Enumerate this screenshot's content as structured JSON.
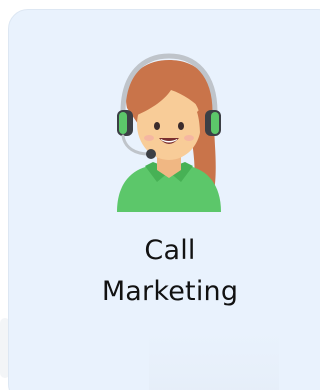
{
  "card": {
    "title_line1": "Call",
    "title_line2": "Marketing",
    "icon": "call-center-agent-icon"
  },
  "colors": {
    "card_background": "#e9f2fd",
    "text": "#121212",
    "shirt": "#5cc76a",
    "hair": "#c9744a",
    "headset": "#bfc4ca"
  }
}
